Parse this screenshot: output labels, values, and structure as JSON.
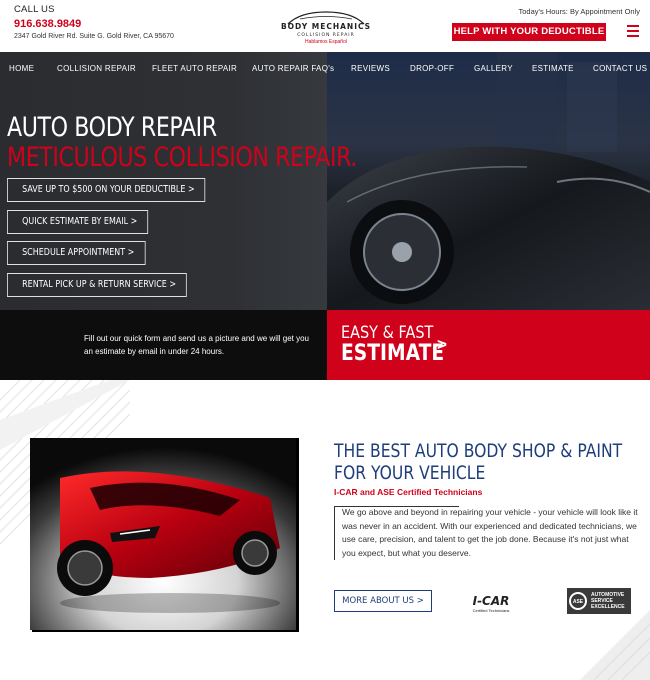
{
  "header": {
    "call_label": "CALL US",
    "phone": "916.638.9849",
    "address": "2347 Gold River Rd. Suite G. Gold River, CA 95670",
    "logo_line1": "BODY MECHANICS",
    "logo_line2": "COLLISION REPAIR",
    "logo_line3": "Hablamos Español",
    "hours": "Today's Hours: By Appointment Only",
    "help_button": "HELP WITH YOUR DEDUCTIBLE",
    "menu_icon": "hamburger-icon"
  },
  "nav": {
    "items": [
      "HOME",
      "COLLISION REPAIR",
      "FLEET AUTO REPAIR",
      "AUTO REPAIR FAQ's",
      "REVIEWS",
      "DROP-OFF",
      "GALLERY",
      "ESTIMATE",
      "CONTACT US"
    ]
  },
  "hero": {
    "title": "AUTO BODY REPAIR",
    "subtitle": "METICULOUS COLLISION REPAIR.",
    "ctas": [
      "SAVE UP TO $500 ON YOUR DEDUCTIBLE >",
      "QUICK ESTIMATE BY EMAIL >",
      "SCHEDULE APPOINTMENT >",
      "RENTAL PICK UP & RETURN SERVICE >"
    ]
  },
  "estimate_band": {
    "text": "Fill out our quick form and send us a picture and we will get you an estimate by email in under 24 hours.",
    "line1": "EASY & FAST",
    "line2": "ESTIMATE",
    "chevron": ">"
  },
  "about": {
    "heading_line1": "THE BEST AUTO BODY SHOP & PAINT",
    "heading_line2": "FOR YOUR VEHICLE",
    "certs": "I-CAR and ASE Certified Technicians",
    "description": "We go above and beyond in repairing your vehicle - your vehicle will look like it was never in an accident. With our experienced and dedicated technicians, we use care, precision, and talent to get the job done. Because it's not just what you expect, but what you deserve.",
    "more_button": "MORE ABOUT US >",
    "icar_logo": "I-CAR",
    "icar_sub": "Certified Technicians",
    "ase_lines": [
      "AUTOMOTIVE",
      "SERVICE",
      "EXCELLENCE"
    ],
    "ase_badge": "ASE"
  },
  "colors": {
    "brand_red": "#d0021b",
    "navy": "#1e3d7a",
    "band_black": "#0d0d0d"
  }
}
